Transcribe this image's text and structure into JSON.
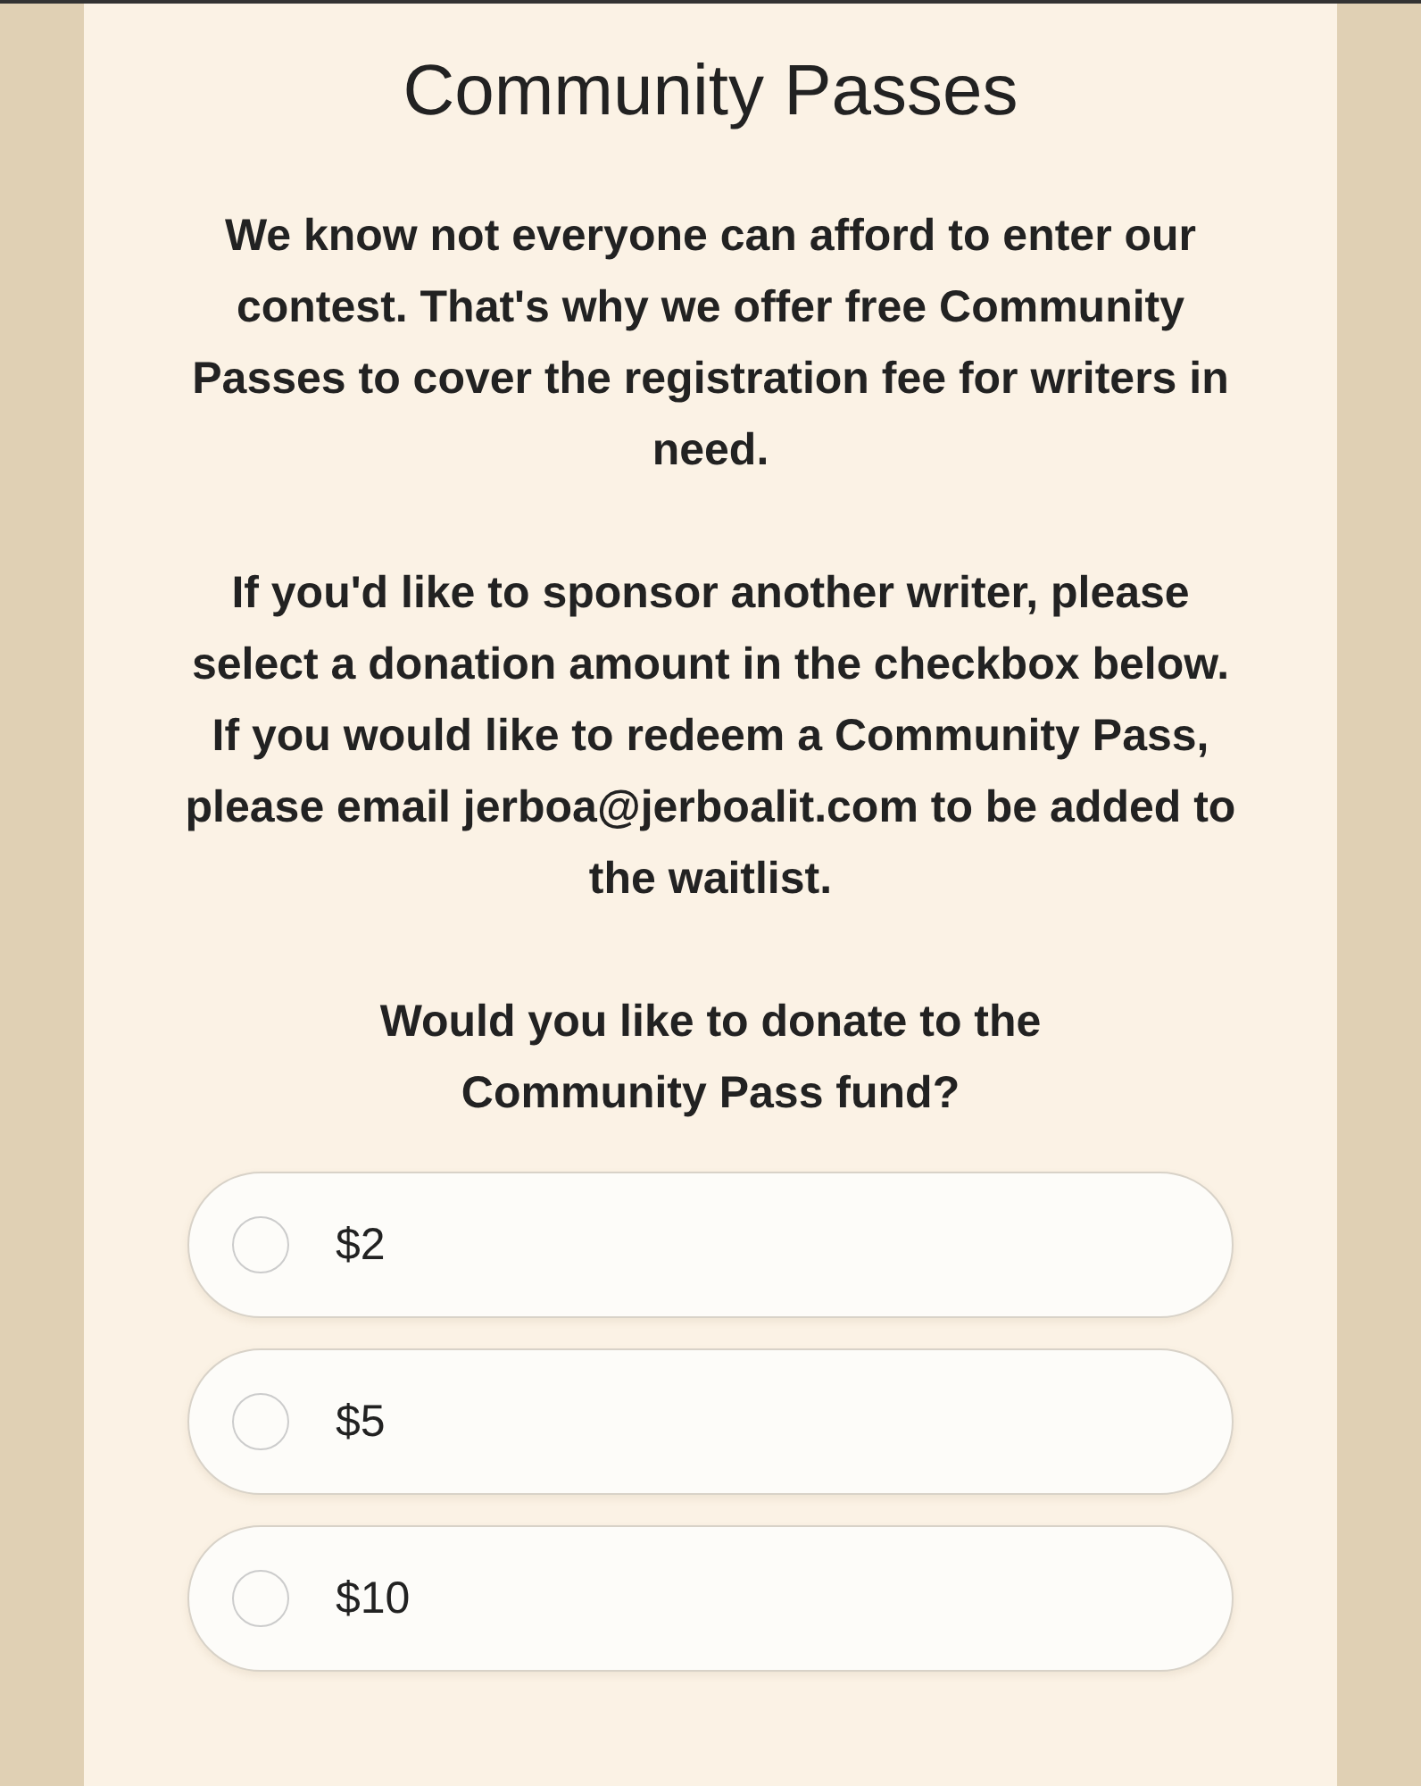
{
  "title": "Community Passes",
  "paragraphs": [
    "We know not everyone can afford to enter our contest. That's why we offer free Community Passes to cover the registration fee for writers in need.",
    "If you'd like to sponsor another writer, please select a donation amount in the checkbox below. If you would like to redeem a Community Pass, please email jerboa@jerboalit.com to be added to the waitlist."
  ],
  "question": "Would you like to donate to the Community Pass fund?",
  "options": [
    {
      "label": "$2",
      "selected": false
    },
    {
      "label": "$5",
      "selected": false
    },
    {
      "label": "$10",
      "selected": false
    }
  ]
}
